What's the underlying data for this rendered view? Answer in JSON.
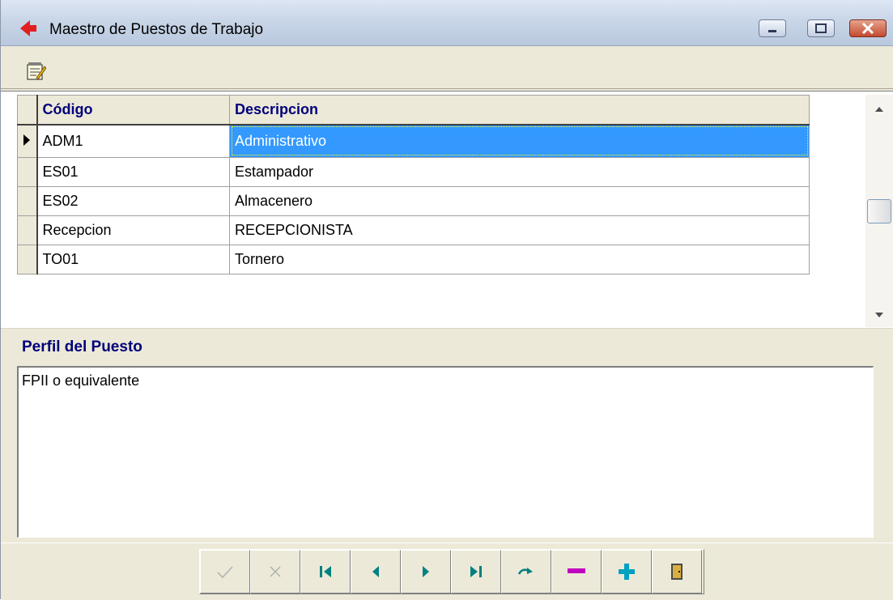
{
  "window": {
    "title": "Maestro de Puestos de Trabajo",
    "buttons": [
      "minimize",
      "maximize",
      "close"
    ]
  },
  "toolbar": {
    "icons": [
      "edit-report-icon"
    ]
  },
  "grid": {
    "columns": [
      "Código",
      "Descripcion"
    ],
    "rows": [
      {
        "code": "ADM1",
        "desc": "Administrativo",
        "selected": true
      },
      {
        "code": "ES01",
        "desc": "Estampador",
        "selected": false
      },
      {
        "code": "ES02",
        "desc": "Almacenero",
        "selected": false
      },
      {
        "code": "Recepcion",
        "desc": "RECEPCIONISTA",
        "selected": false
      },
      {
        "code": "TO01",
        "desc": "Tornero",
        "selected": false
      }
    ]
  },
  "perfil": {
    "label": "Perfil del Puesto",
    "value": "FPII o equivalente"
  },
  "navigator": {
    "buttons": [
      "post-icon",
      "cancel-icon",
      "first-icon",
      "prior-icon",
      "next-icon",
      "last-icon",
      "refresh-icon",
      "delete-icon",
      "insert-icon",
      "exit-door-icon"
    ]
  },
  "colors": {
    "selection": "#3399ff",
    "header_text": "#00007a",
    "nav_teal": "#008080",
    "delete_magenta": "#c000c0",
    "insert_teal": "#00a0c0"
  }
}
